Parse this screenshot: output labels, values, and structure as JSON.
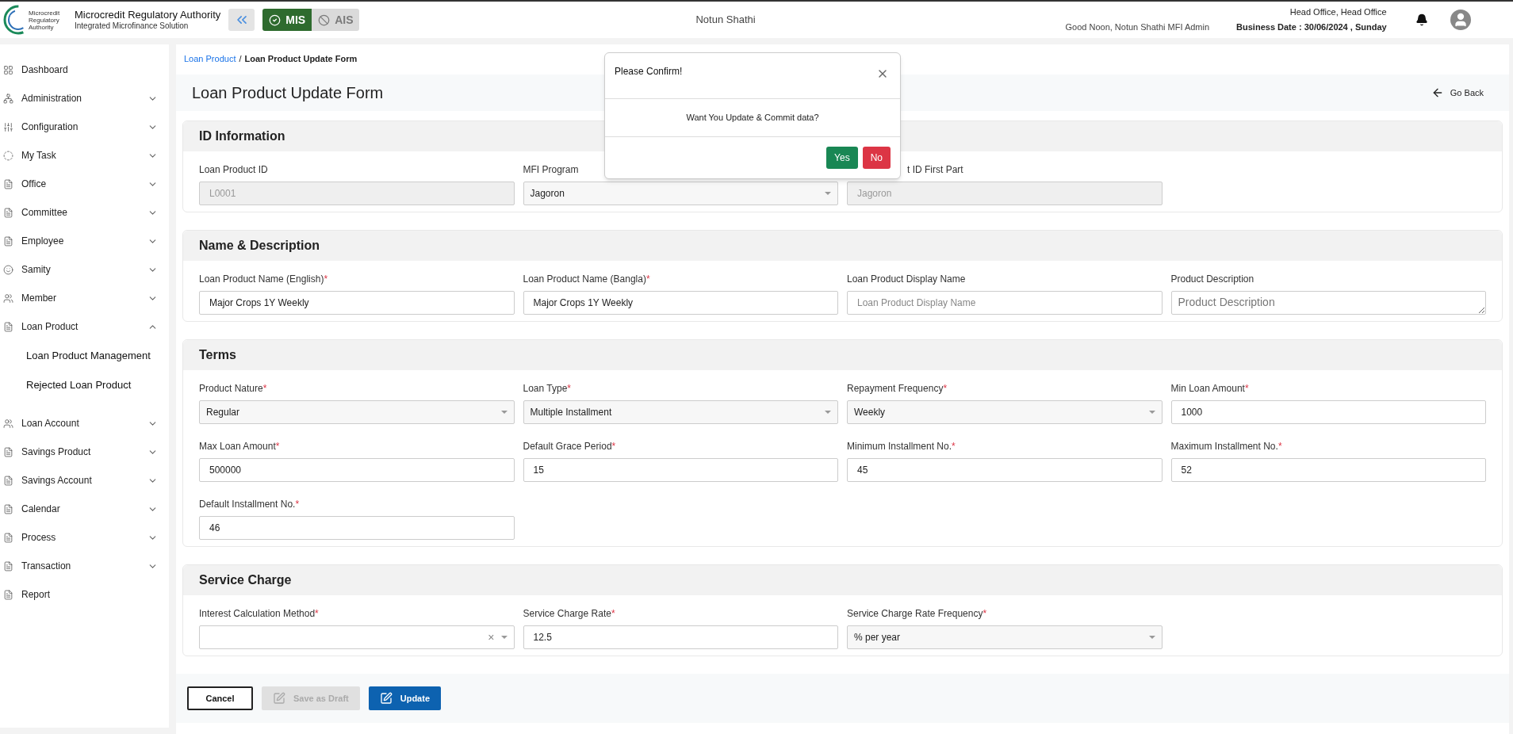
{
  "header": {
    "logo_text": "Microcredit Regulatory Authority",
    "org_name": "Microcredit Regulatory Authority",
    "org_subtitle": "Integrated Microfinance Solution",
    "modes": [
      {
        "label": "MIS",
        "selected": true
      },
      {
        "label": "AIS",
        "selected": false
      }
    ],
    "center_title": "Notun Shathi",
    "greeting": "Good Noon, Notun Shathi MFI Admin",
    "office": "Head Office, Head Office",
    "business_date": "Business Date : 30/06/2024 , Sunday"
  },
  "sidebar": {
    "items": [
      {
        "label": "Dashboard"
      },
      {
        "label": "Administration",
        "expanded": false
      },
      {
        "label": "Configuration",
        "expanded": false
      },
      {
        "label": "My Task",
        "expanded": false
      },
      {
        "label": "Office",
        "expanded": false
      },
      {
        "label": "Committee",
        "expanded": false
      },
      {
        "label": "Employee",
        "expanded": false
      },
      {
        "label": "Samity",
        "expanded": false
      },
      {
        "label": "Member",
        "expanded": false
      },
      {
        "label": "Loan Product",
        "expanded": true,
        "children": [
          {
            "label": "Loan Product Management"
          },
          {
            "label": "Rejected Loan Product"
          }
        ]
      },
      {
        "label": "Loan Account",
        "expanded": false
      },
      {
        "label": "Savings Product",
        "expanded": false
      },
      {
        "label": "Savings Account",
        "expanded": false
      },
      {
        "label": "Calendar",
        "expanded": false
      },
      {
        "label": "Process",
        "expanded": false
      },
      {
        "label": "Transaction",
        "expanded": false
      },
      {
        "label": "Report"
      }
    ]
  },
  "breadcrumb": {
    "items": [
      {
        "label": "Loan Product",
        "kind": "link"
      },
      {
        "label": "Loan Product Update Form",
        "kind": "current"
      }
    ],
    "separator": "/"
  },
  "page_title": "Loan Product Update Form",
  "go_back": "Go Back",
  "sections": [
    {
      "title": "ID Information",
      "fields": [
        {
          "label": "Loan Product ID",
          "kind": "disabled",
          "value": "L0001"
        },
        {
          "label": "MFI Program",
          "kind": "select",
          "value": "Jagoron"
        },
        {
          "label": "t ID First Part",
          "kind": "disabled",
          "value": "Jagoron",
          "covered": true
        }
      ]
    },
    {
      "title": "Name & Description",
      "fields": [
        {
          "label": "Loan Product Name (English)",
          "required_mark": "*",
          "kind": "input",
          "value": "Major Crops 1Y Weekly"
        },
        {
          "label": "Loan Product Name (Bangla)",
          "required_mark": "*",
          "kind": "input",
          "value": "Major Crops 1Y Weekly"
        },
        {
          "label": "Loan Product Display Name",
          "kind": "input",
          "placeholder": "Loan Product Display Name"
        },
        {
          "label": "Product Description",
          "kind": "textarea",
          "placeholder": "Product Description"
        }
      ]
    },
    {
      "title": "Terms",
      "fields": [
        {
          "label": "Product Nature",
          "required_mark": "*",
          "kind": "select",
          "value": "Regular"
        },
        {
          "label": "Loan Type",
          "required_mark": "*",
          "kind": "select",
          "value": "Multiple Installment"
        },
        {
          "label": "Repayment Frequency",
          "required_mark": "*",
          "kind": "select",
          "value": "Weekly"
        },
        {
          "label": "Min Loan Amount",
          "required_mark": "*",
          "kind": "input",
          "value": "1000"
        },
        {
          "label": "Max Loan Amount",
          "required_mark": "*",
          "kind": "input",
          "value": "500000"
        },
        {
          "label": "Default Grace Period",
          "required_mark": "*",
          "kind": "input",
          "value": "15"
        },
        {
          "label": "Minimum Installment No.",
          "required_mark": "*",
          "kind": "input",
          "value": "45"
        },
        {
          "label": "Maximum Installment No.",
          "required_mark": "*",
          "kind": "input",
          "value": "52"
        },
        {
          "label": "Default Installment No.",
          "required_mark": "*",
          "kind": "input",
          "value": "46"
        }
      ]
    },
    {
      "title": "Service Charge",
      "fields": [
        {
          "label": "Interest Calculation Method",
          "required_mark": "*",
          "kind": "select",
          "clear_glyph": "×"
        },
        {
          "label": "Service Charge Rate",
          "required_mark": "*",
          "kind": "input",
          "value": "12.5"
        },
        {
          "label": "Service Charge Rate Frequency",
          "required_mark": "*",
          "kind": "select",
          "value": "% per year"
        }
      ]
    }
  ],
  "actions": [
    {
      "label": "Cancel",
      "kind": "outline"
    },
    {
      "label": "Save as Draft",
      "kind": "edit",
      "disabled": true
    },
    {
      "label": "Update",
      "kind": "edit",
      "disabled": false
    }
  ],
  "dialog": {
    "title": "Please Confirm!",
    "message": "Want You Update & Commit data?",
    "buttons": [
      {
        "label": "Yes",
        "kind": "confirm"
      },
      {
        "label": "No",
        "kind": "cancel"
      }
    ]
  }
}
